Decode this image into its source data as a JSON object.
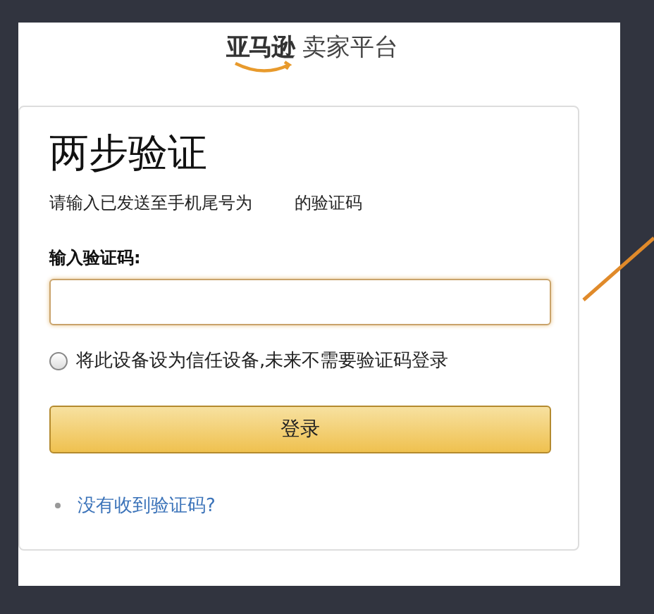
{
  "logo": {
    "brand": "亚马逊",
    "product": "卖家平台"
  },
  "card": {
    "title": "两步验证",
    "subtitle_parts": [
      "请输入已发送至手机尾号为",
      "的验证码"
    ],
    "field": {
      "label": "输入验证码:"
    },
    "trust_device": {
      "label": "将此设备设为信任设备,未来不需要验证码登录",
      "checked": false
    },
    "submit": "登录",
    "help_link": "没有收到验证码?"
  }
}
